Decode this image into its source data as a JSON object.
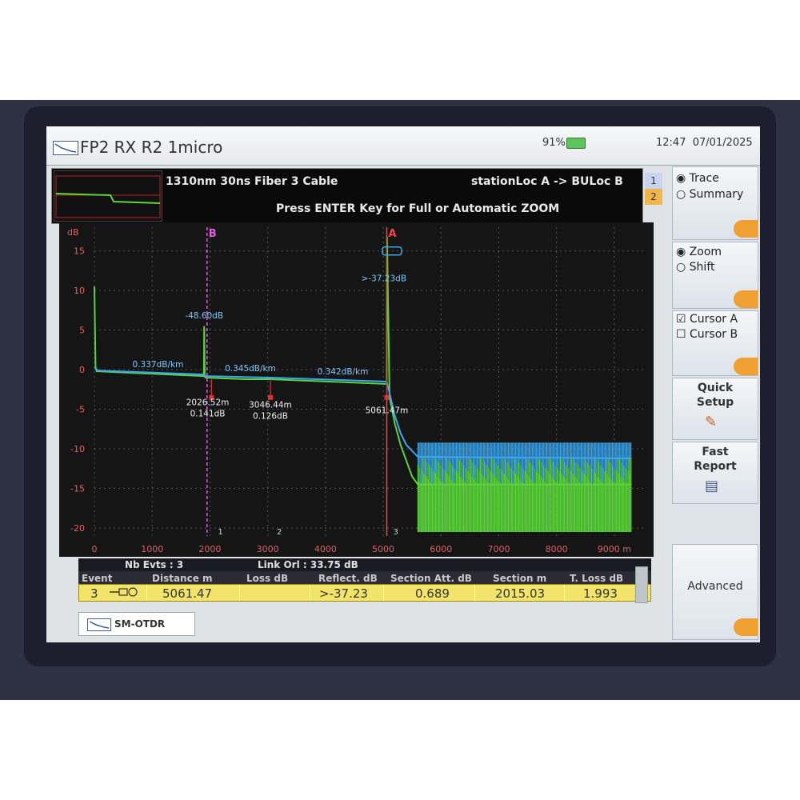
{
  "title": "FP2 RX R2 1micro",
  "status": {
    "battery": "91%",
    "time": "12:47",
    "date": "07/01/2025"
  },
  "info": {
    "line1": "1310nm  30ns  Fiber  3  Cable",
    "route": "stationLoc A -> BULoc B",
    "hint": "Press ENTER Key for Full or Automatic ZOOM",
    "traces": [
      "1",
      "2"
    ]
  },
  "chart_data": {
    "type": "line",
    "xlabel": "",
    "ylabel": "dB",
    "x_unit": "m",
    "xlim": [
      0,
      9500
    ],
    "ylim": [
      -21,
      18
    ],
    "x_ticks": [
      0,
      1000,
      2000,
      3000,
      4000,
      5000,
      6000,
      7000,
      8000,
      9000
    ],
    "x_tick_labels": [
      "0",
      "1000",
      "2000",
      "3000",
      "4000",
      "5000",
      "6000",
      "7000",
      "8000",
      "9000 m"
    ],
    "y_ticks": [
      15,
      10,
      5,
      0,
      -5,
      -10,
      -15,
      -20
    ],
    "y_tick_labels": [
      "15",
      "10",
      "5",
      "0",
      "-5",
      "-10",
      "-15",
      "-20"
    ],
    "grid": true,
    "series": [
      {
        "color": "#5ad43a",
        "x": [
          0,
          20,
          40,
          60,
          1895,
          1900,
          1910,
          1925,
          2600,
          3046,
          5060,
          5065,
          5110,
          5200,
          5300,
          5400,
          5500,
          5600,
          9300
        ],
        "y": [
          10.5,
          0.3,
          -0.2,
          -0.2,
          -0.8,
          5.5,
          -0.9,
          -1.0,
          -1.2,
          -1.2,
          -1.8,
          16.8,
          -3.5,
          -6.8,
          -9.5,
          -11.5,
          -13.5,
          -14.5,
          -14.5
        ]
      },
      {
        "color": "#3aa8f0",
        "x": [
          0,
          60,
          1895,
          1925,
          3046,
          5060,
          5110,
          5200,
          5300,
          5400,
          5600,
          9300
        ],
        "y": [
          0.3,
          -0.1,
          -0.6,
          -0.8,
          -1.0,
          -1.5,
          -3.0,
          -5.8,
          -8.0,
          -9.5,
          -11.0,
          -11.2
        ]
      }
    ],
    "annotations": [
      {
        "text": "-48.60dB",
        "x": 1900,
        "y": 6.5
      },
      {
        "text": "0.337dB/km",
        "x": 1100,
        "y": 0.3
      },
      {
        "text": "0.345dB/km",
        "x": 2700,
        "y": -0.2
      },
      {
        "text": "0.342dB/km",
        "x": 4300,
        "y": -0.6
      },
      {
        "text": "2026.52m",
        "x": 1960,
        "y": -4.5
      },
      {
        "text": "0.141dB",
        "x": 1960,
        "y": -5.9
      },
      {
        "text": "3046.44m",
        "x": 3046,
        "y": -4.8
      },
      {
        "text": "0.126dB",
        "x": 3046,
        "y": -6.2
      },
      {
        "text": "5061.47m",
        "x": 5061,
        "y": -5.5
      },
      {
        "text": ">-37.23dB",
        "x": 5010,
        "y": 11.2
      }
    ],
    "events": [
      {
        "label": "1",
        "x": 2026.52
      },
      {
        "label": "2",
        "x": 3046.44
      },
      {
        "label": "3",
        "x": 5061.47
      }
    ],
    "cursors": [
      {
        "label": "A",
        "x": 5061.47,
        "color": "#ff4040"
      },
      {
        "label": "B",
        "x": 1950,
        "color": "#e060e0"
      }
    ]
  },
  "events_bar": {
    "nb_evts": "Nb Evts : 3",
    "link_orl": "Link Orl : 33.75 dB"
  },
  "table": {
    "headers": [
      "Event",
      "Distance  m",
      "Loss dB",
      "Reflect. dB",
      "Section Att. dB",
      "Section m",
      "T. Loss dB"
    ],
    "row": {
      "event": "3",
      "distance": "5061.47",
      "loss": "",
      "reflect": ">-37.23",
      "section_att": "0.689",
      "section_m": "2015.03",
      "t_loss": "1.993"
    }
  },
  "tab": {
    "label": "SM-OTDR"
  },
  "sidebar": {
    "trace": "Trace",
    "summary": "Summary",
    "zoom": "Zoom",
    "shift": "Shift",
    "cursor_a": "Cursor A",
    "cursor_b": "Cursor B",
    "quick_setup_1": "Quick",
    "quick_setup_2": "Setup",
    "fast_report_1": "Fast",
    "fast_report_2": "Report",
    "advanced": "Advanced"
  },
  "colors": {
    "trace_green": "#5ad43a",
    "trace_blue": "#3aa8f0",
    "cursor_a": "#ff4040",
    "cursor_b": "#e060e0",
    "accent_orange": "#f0a030",
    "highlight_yellow": "#f2e36a"
  }
}
